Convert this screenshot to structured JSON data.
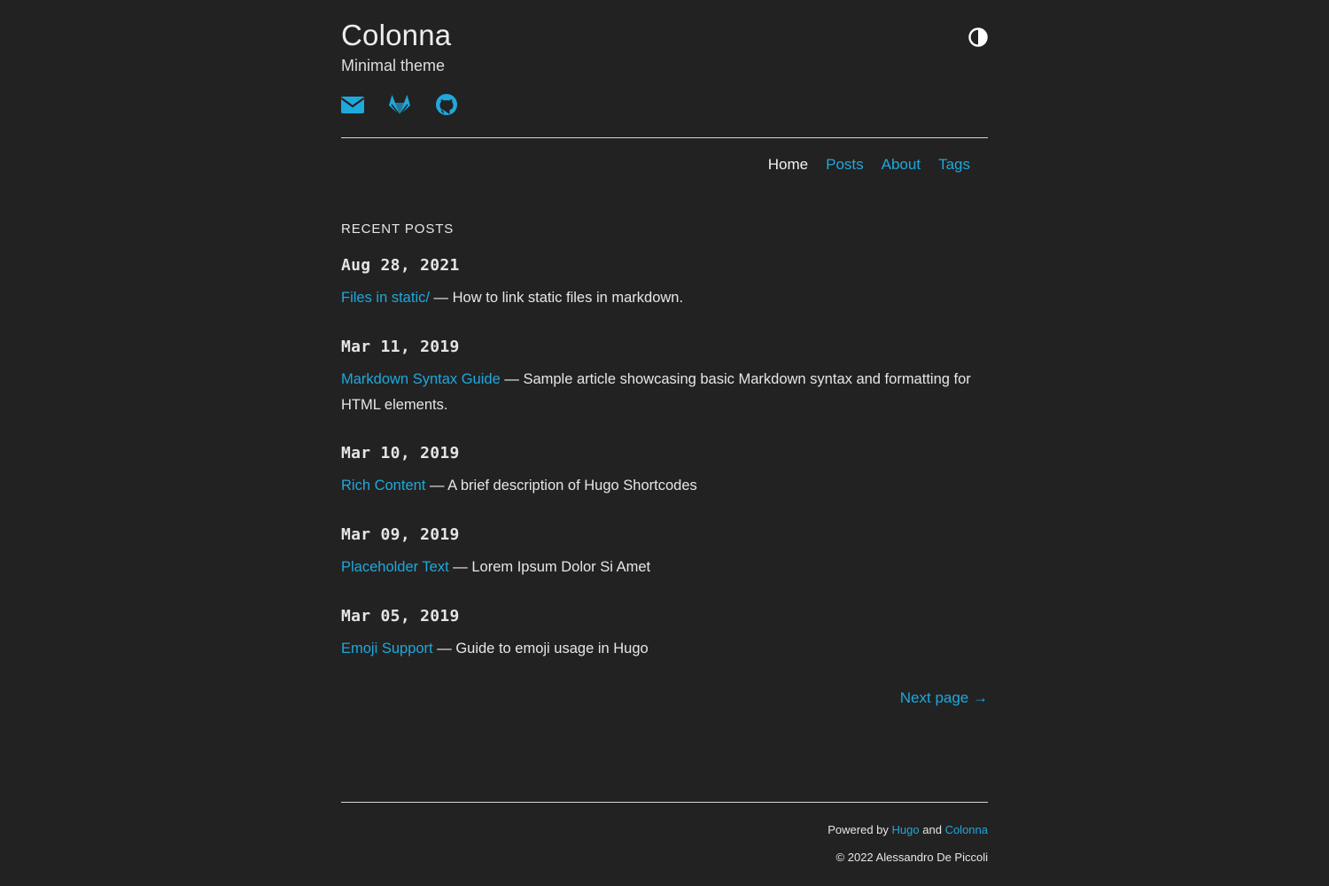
{
  "header": {
    "title": "Colonna",
    "subtitle": "Minimal theme",
    "theme_toggle_icon": "half-circle-contrast-icon",
    "social": [
      {
        "icon": "envelope-icon"
      },
      {
        "icon": "gitlab-icon"
      },
      {
        "icon": "github-icon"
      }
    ]
  },
  "nav": {
    "items": [
      {
        "label": "Home",
        "active": true
      },
      {
        "label": "Posts",
        "active": false
      },
      {
        "label": "About",
        "active": false
      },
      {
        "label": "Tags",
        "active": false
      }
    ]
  },
  "main": {
    "section_title": "RECENT POSTS",
    "separator": "—",
    "posts": [
      {
        "date": "Aug 28, 2021",
        "title": "Files in static/",
        "summary": "How to link static files in markdown."
      },
      {
        "date": "Mar 11, 2019",
        "title": "Markdown Syntax Guide",
        "summary": "Sample article showcasing basic Markdown syntax and formatting for HTML elements."
      },
      {
        "date": "Mar 10, 2019",
        "title": "Rich Content",
        "summary": "A brief description of Hugo Shortcodes"
      },
      {
        "date": "Mar 09, 2019",
        "title": "Placeholder Text",
        "summary": "Lorem Ipsum Dolor Si Amet"
      },
      {
        "date": "Mar 05, 2019",
        "title": "Emoji Support",
        "summary": "Guide to emoji usage in Hugo"
      }
    ],
    "next_page": "Next page →"
  },
  "footer": {
    "powered_by": "Powered by",
    "hugo": "Hugo",
    "and": "and",
    "colonna": "Colonna",
    "copyright": "© 2022 Alessandro De Piccoli"
  },
  "colors": {
    "background": "#222222",
    "accent": "#1fa8dc",
    "text": "#e6e6e6"
  }
}
